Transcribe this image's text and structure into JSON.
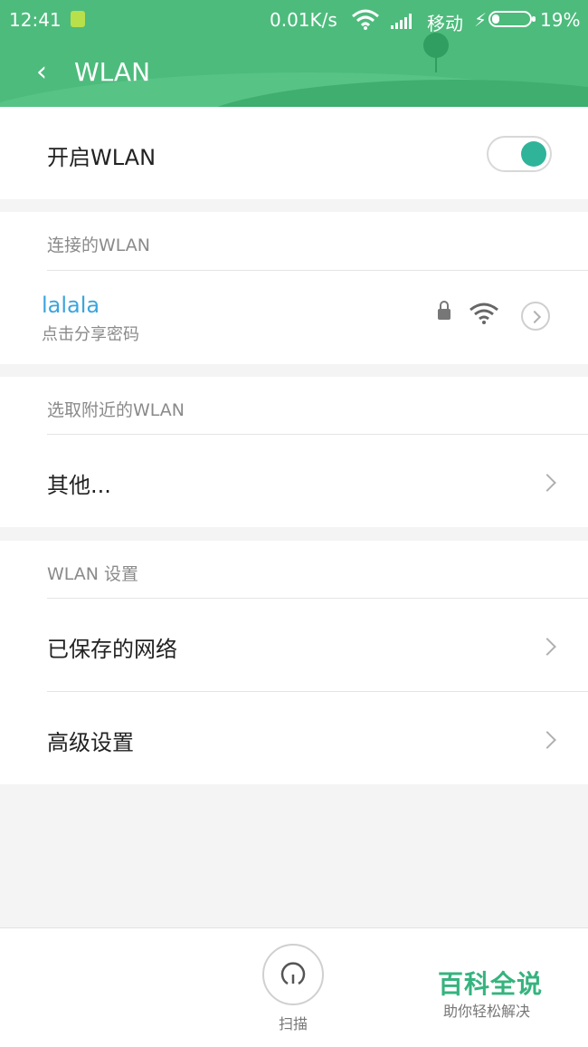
{
  "status_bar": {
    "time": "12:41",
    "speed": "0.01K/s",
    "carrier": "移动",
    "battery_percent": "19%",
    "battery_level": 0.19,
    "icons": [
      "sim-icon",
      "wifi-icon",
      "signal-icon",
      "charging-bolt-icon",
      "battery-icon"
    ]
  },
  "header": {
    "back_icon": "back-arrow-icon",
    "title": "WLAN"
  },
  "wlan_toggle": {
    "label": "开启WLAN",
    "enabled": true,
    "accent": "#2fb49a"
  },
  "connected": {
    "section_title": "连接的WLAN",
    "network_name": "lalala",
    "network_subtitle": "点击分享密码",
    "name_color": "#3aa5dc",
    "icons": [
      "lock-icon",
      "wifi-strength-icon",
      "details-chevron-icon"
    ]
  },
  "nearby": {
    "section_title": "选取附近的WLAN",
    "other_label": "其他..."
  },
  "settings": {
    "section_title": "WLAN 设置",
    "saved_networks_label": "已保存的网络",
    "advanced_label": "高级设置"
  },
  "bottom_bar": {
    "scan_label": "扫描",
    "scan_icon": "scan-icon"
  },
  "watermark": {
    "title": "百科全说",
    "subtitle": "助你轻松解决",
    "color": "#36b37e"
  },
  "colors": {
    "header_bg": "#4dbb7c",
    "page_bg": "#f4f4f4"
  }
}
